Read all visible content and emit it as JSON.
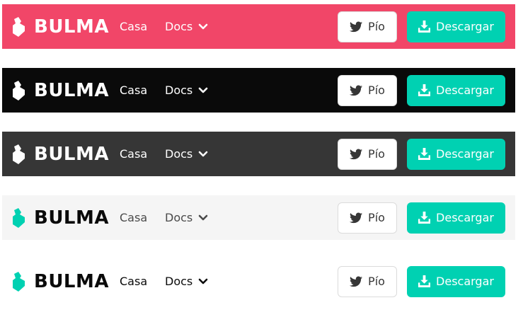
{
  "navbars": [
    {
      "theme": "primary",
      "background": "#f14668",
      "brand": "BULMA",
      "links": {
        "home": "Casa",
        "docs": "Docs"
      },
      "buttons": {
        "tweet": "Pío",
        "download": "Descargar"
      }
    },
    {
      "theme": "black",
      "background": "#0a0a0a",
      "brand": "BULMA",
      "links": {
        "home": "Casa",
        "docs": "Docs"
      },
      "buttons": {
        "tweet": "Pío",
        "download": "Descargar"
      }
    },
    {
      "theme": "dark",
      "background": "#363636",
      "brand": "BULMA",
      "links": {
        "home": "Casa",
        "docs": "Docs"
      },
      "buttons": {
        "tweet": "Pío",
        "download": "Descargar"
      }
    },
    {
      "theme": "light",
      "background": "#f5f5f5",
      "brand": "BULMA",
      "links": {
        "home": "Casa",
        "docs": "Docs"
      },
      "buttons": {
        "tweet": "Pío",
        "download": "Descargar"
      }
    },
    {
      "theme": "white",
      "background": "#ffffff",
      "brand": "BULMA",
      "links": {
        "home": "Casa",
        "docs": "Docs"
      },
      "buttons": {
        "tweet": "Pío",
        "download": "Descargar"
      }
    }
  ],
  "icons": {
    "brand": "bulma-logo-icon",
    "docs_dropdown": "chevron-down-icon",
    "tweet": "twitter-icon",
    "download": "download-icon"
  },
  "colors": {
    "accent": "#00d1b2",
    "tweet_button_bg": "#ffffff",
    "tweet_button_border": "#dbdbdb"
  }
}
